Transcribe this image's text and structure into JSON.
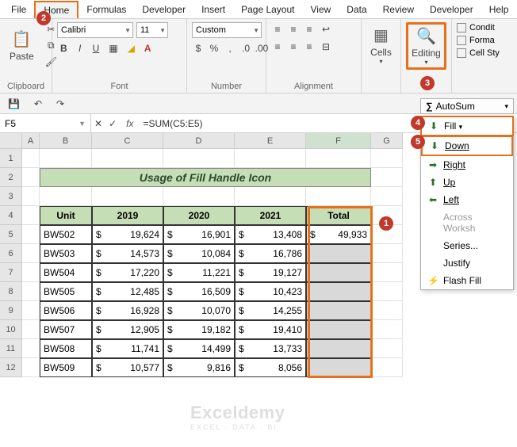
{
  "tabs": {
    "file": "File",
    "home": "Home",
    "formulas": "Formulas",
    "developer": "Developer",
    "insert": "Insert",
    "page_layout": "Page Layout",
    "view": "View",
    "data": "Data",
    "review": "Review",
    "developer2": "Developer",
    "help": "Help"
  },
  "ribbon": {
    "clipboard": {
      "label": "Clipboard",
      "paste": "Paste"
    },
    "font": {
      "label": "Font",
      "name": "Calibri",
      "size": "11",
      "bold": "B",
      "italic": "I",
      "underline": "U"
    },
    "number": {
      "label": "Number",
      "format": "Custom",
      "currency": "$",
      "percent": "%",
      "comma": ","
    },
    "alignment": {
      "label": "Alignment"
    },
    "cells": {
      "label": "Cells"
    },
    "editing": {
      "label": "Editing"
    },
    "right": {
      "condit": "Condit",
      "format": "Forma",
      "cellsty": "Cell Sty"
    }
  },
  "autosum": "AutoSum",
  "fillmenu": {
    "fill": "Fill",
    "down": "Down",
    "right": "Right",
    "up": "Up",
    "left": "Left",
    "across": "Across Worksh",
    "series": "Series...",
    "justify": "Justify",
    "flash": "Flash Fill"
  },
  "namebox": "F5",
  "formula": "=SUM(C5:E5)",
  "colHeaders": [
    "A",
    "B",
    "C",
    "D",
    "E",
    "F",
    "G"
  ],
  "banner": "Usage of Fill Handle Icon",
  "headers": {
    "unit": "Unit",
    "y1": "2019",
    "y2": "2020",
    "y3": "2021",
    "total": "Total"
  },
  "currency": "$",
  "rows": [
    {
      "unit": "BW502",
      "y1": "19,624",
      "y2": "16,901",
      "y3": "13,408",
      "total": "49,933"
    },
    {
      "unit": "BW503",
      "y1": "14,573",
      "y2": "10,084",
      "y3": "16,786",
      "total": ""
    },
    {
      "unit": "BW504",
      "y1": "17,220",
      "y2": "11,221",
      "y3": "19,127",
      "total": ""
    },
    {
      "unit": "BW505",
      "y1": "12,485",
      "y2": "16,509",
      "y3": "10,423",
      "total": ""
    },
    {
      "unit": "BW506",
      "y1": "16,928",
      "y2": "10,070",
      "y3": "14,255",
      "total": ""
    },
    {
      "unit": "BW507",
      "y1": "12,905",
      "y2": "19,182",
      "y3": "19,410",
      "total": ""
    },
    {
      "unit": "BW508",
      "y1": "11,741",
      "y2": "14,499",
      "y3": "13,733",
      "total": ""
    },
    {
      "unit": "BW509",
      "y1": "10,577",
      "y2": "9,816",
      "y3": "8,056",
      "total": ""
    }
  ],
  "badges": {
    "b1": "1",
    "b2": "2",
    "b3": "3",
    "b4": "4",
    "b5": "5"
  },
  "watermark": {
    "main": "Exceldemy",
    "sub": "EXCEL · DATA · BI"
  }
}
